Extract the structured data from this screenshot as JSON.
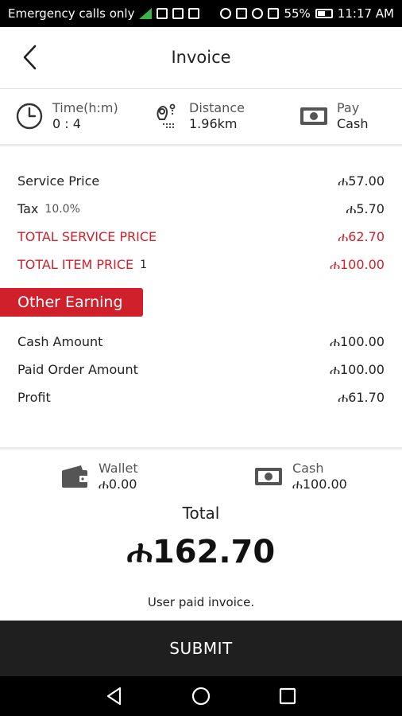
{
  "status_bar": {
    "carrier_text": "Emergency calls only",
    "battery_percent": "55%",
    "time": "11:17 AM",
    "signal_color": "#3bb54a"
  },
  "header": {
    "title": "Invoice",
    "back_icon": "chevron-left-icon"
  },
  "trip": {
    "time": {
      "label": "Time(h:m)",
      "value": "0 : 4",
      "icon": "clock-icon"
    },
    "distance": {
      "label": "Distance",
      "value": "1.96km",
      "icon": "route-pin-icon"
    },
    "pay": {
      "label": "Pay",
      "value": "Cash",
      "icon": "cash-icon"
    }
  },
  "prices": {
    "service_price": {
      "label": "Service Price",
      "value": "ሐ57.00"
    },
    "tax": {
      "label": "Tax",
      "rate": "10.0%",
      "value": "ሐ5.70"
    },
    "total_service_price": {
      "label": "TOTAL SERVICE PRICE",
      "value": "ሐ62.70"
    },
    "total_item_price": {
      "label": "TOTAL ITEM PRICE",
      "count": "1",
      "value": "ሐ100.00"
    }
  },
  "other_earning": {
    "heading": "Other Earning",
    "cash_amount": {
      "label": "Cash Amount",
      "value": "ሐ100.00"
    },
    "paid_order_amount": {
      "label": "Paid Order Amount",
      "value": "ሐ100.00"
    },
    "profit": {
      "label": "Profit",
      "value": "ሐ61.70"
    }
  },
  "payment": {
    "wallet": {
      "label": "Wallet",
      "value": "ሐ0.00",
      "icon": "wallet-icon"
    },
    "cash": {
      "label": "Cash",
      "value": "ሐ100.00",
      "icon": "cash-icon"
    },
    "total_label": "Total",
    "total_amount": "ሐ162.70",
    "note": "User paid invoice."
  },
  "submit_label": "SUBMIT",
  "colors": {
    "accent_red": "#d0202b",
    "dark_bar": "#1f1f1f"
  }
}
